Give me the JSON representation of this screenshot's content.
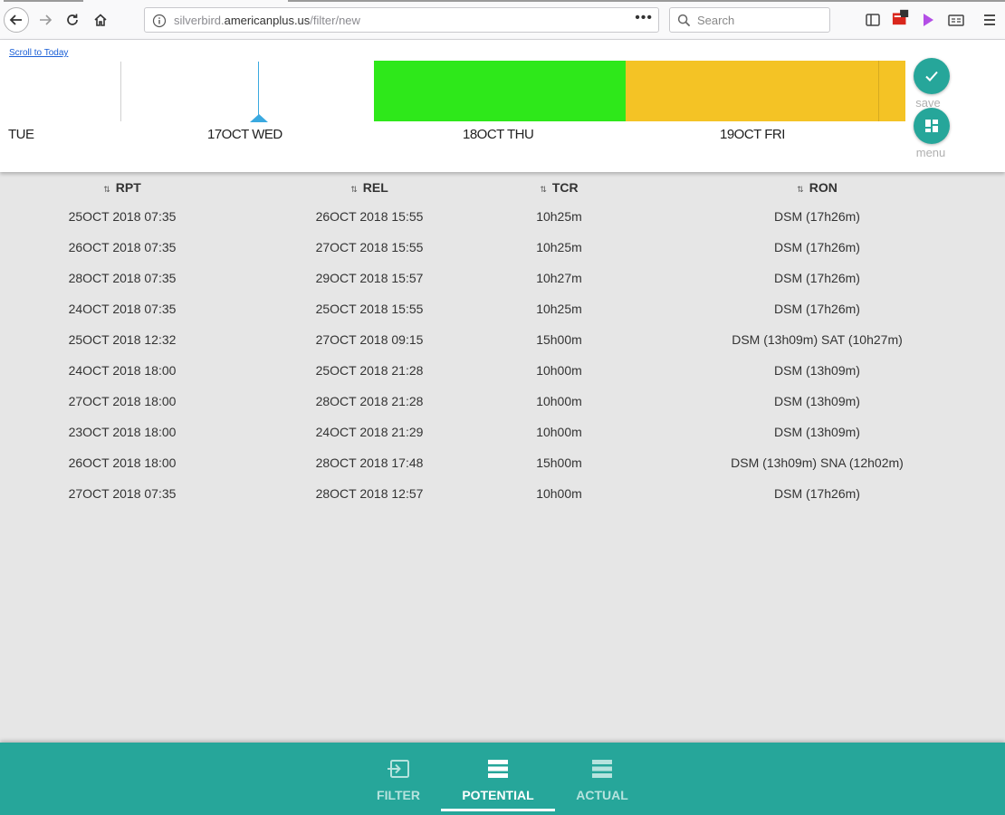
{
  "browser": {
    "url_host_prefix": "silverbird.",
    "url_host": "americanplus.us",
    "url_path": "/filter/new",
    "url_dots": "•••",
    "search_placeholder": "Search"
  },
  "timeline": {
    "scroll_today": "Scroll to Today",
    "days": [
      "TUE",
      "17OCT WED",
      "18OCT THU",
      "19OCT FRI"
    ],
    "bar_colors": {
      "green": "#2ee81a",
      "yellow": "#f4c325"
    },
    "today_marker_color": "#3aa9e0",
    "save_label": "save",
    "menu_label": "menu"
  },
  "table": {
    "columns": [
      "RPT",
      "REL",
      "TCR",
      "RON"
    ],
    "rows": [
      [
        "25OCT 2018 07:35",
        "26OCT 2018 15:55",
        "10h25m",
        "DSM (17h26m)"
      ],
      [
        "26OCT 2018 07:35",
        "27OCT 2018 15:55",
        "10h25m",
        "DSM (17h26m)"
      ],
      [
        "28OCT 2018 07:35",
        "29OCT 2018 15:57",
        "10h27m",
        "DSM (17h26m)"
      ],
      [
        "24OCT 2018 07:35",
        "25OCT 2018 15:55",
        "10h25m",
        "DSM (17h26m)"
      ],
      [
        "25OCT 2018 12:32",
        "27OCT 2018 09:15",
        "15h00m",
        "DSM (13h09m) SAT (10h27m)"
      ],
      [
        "24OCT 2018 18:00",
        "25OCT 2018 21:28",
        "10h00m",
        "DSM (13h09m)"
      ],
      [
        "27OCT 2018 18:00",
        "28OCT 2018 21:28",
        "10h00m",
        "DSM (13h09m)"
      ],
      [
        "23OCT 2018 18:00",
        "24OCT 2018 21:29",
        "10h00m",
        "DSM (13h09m)"
      ],
      [
        "26OCT 2018 18:00",
        "28OCT 2018 17:48",
        "15h00m",
        "DSM (13h09m) SNA (12h02m)"
      ],
      [
        "27OCT 2018 07:35",
        "28OCT 2018 12:57",
        "10h00m",
        "DSM (17h26m)"
      ]
    ]
  },
  "bottom_nav": {
    "tabs": [
      "FILTER",
      "POTENTIAL",
      "ACTUAL"
    ],
    "active_tab": "POTENTIAL",
    "color": "#26a69a"
  }
}
